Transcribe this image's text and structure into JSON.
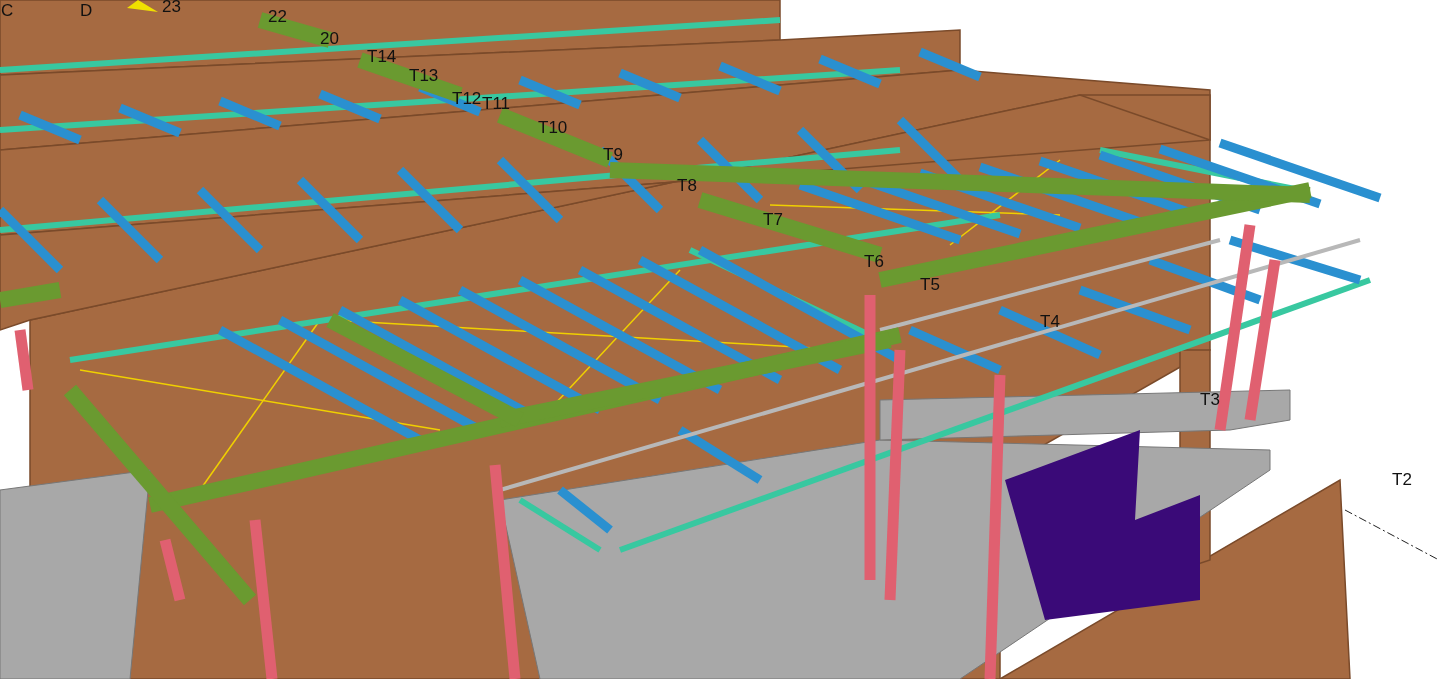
{
  "viewport": {
    "labels": [
      "C",
      "D",
      "23",
      "22",
      "20",
      "T14",
      "T13",
      "T12",
      "T11",
      "T10",
      "T9",
      "T8",
      "T7",
      "T6",
      "T5",
      "T4",
      "T3",
      "T2"
    ]
  }
}
